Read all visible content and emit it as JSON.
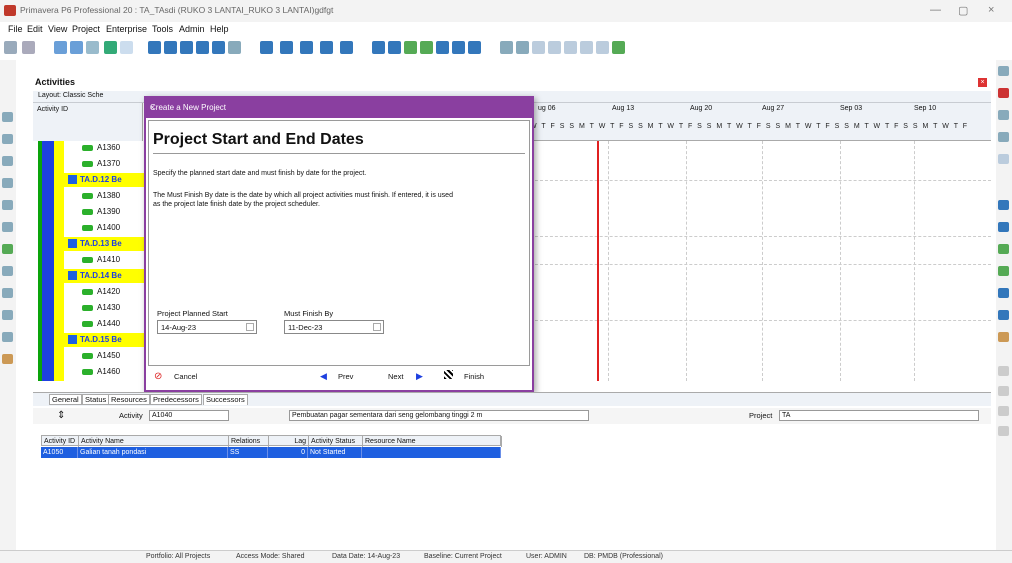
{
  "window": {
    "title": "Primavera P6 Professional 20 : TA_TAsdi (RUKO 3 LANTAI_RUKO 3 LANTAI)gdfgt",
    "minimize": "—",
    "restore": "▢",
    "close": "×"
  },
  "menu": [
    "File",
    "Edit",
    "View",
    "Project",
    "Enterprise",
    "Tools",
    "Admin",
    "Help"
  ],
  "activities_panel": {
    "title": "Activities",
    "layout": "Layout: Classic Sche",
    "column": "Activity ID"
  },
  "rows": [
    {
      "label": "A1360",
      "type": "act"
    },
    {
      "label": "A1370",
      "type": "act"
    },
    {
      "label": "TA.D.12 Be",
      "type": "wbs"
    },
    {
      "label": "A1380",
      "type": "act"
    },
    {
      "label": "A1390",
      "type": "act"
    },
    {
      "label": "A1400",
      "type": "act"
    },
    {
      "label": "TA.D.13 Be",
      "type": "wbs"
    },
    {
      "label": "A1410",
      "type": "act"
    },
    {
      "label": "TA.D.14 Be",
      "type": "wbs"
    },
    {
      "label": "A1420",
      "type": "act"
    },
    {
      "label": "A1430",
      "type": "act"
    },
    {
      "label": "A1440",
      "type": "act"
    },
    {
      "label": "TA.D.15 Be",
      "type": "wbs"
    },
    {
      "label": "A1450",
      "type": "act"
    },
    {
      "label": "A1460",
      "type": "act"
    }
  ],
  "gantt": {
    "weeks": [
      "ug 06",
      "Aug 13",
      "Aug 20",
      "Aug 27",
      "Sep 03",
      "Sep 10"
    ],
    "days": "W T F S S M T W T F S S M T W T F S S M T W T F S S M T W T F S S M T W T F S S M T W T F"
  },
  "dialog": {
    "title": "Create a New Project",
    "heading": "Project Start and End Dates",
    "desc1": "Specify the planned start date and must finish by date for the project.",
    "desc2": "The Must Finish By date is the date by which all project activities must finish.  If entered, it is used",
    "desc3": "as the project late finish date by the project scheduler.",
    "start_label": "Project Planned Start",
    "start_value": "14-Aug-23",
    "finish_label": "Must Finish By",
    "finish_value": "11-Dec-23",
    "cancel": "Cancel",
    "prev": "Prev",
    "next": "Next",
    "finish": "Finish"
  },
  "bottom": {
    "tabs": [
      "General",
      "Status",
      "Resources",
      "Predecessors",
      "Successors"
    ],
    "activity_label": "Activity",
    "activity_id": "A1040",
    "activity_name": "Pembuatan pagar sementara dari seng gelombang tinggi 2 m",
    "project_label": "Project",
    "project_id": "TA",
    "columns": [
      "Activity ID",
      "Activity Name",
      "Relations",
      "Lag",
      "Activity Status",
      "Resource Name"
    ],
    "row": {
      "id": "A1050",
      "name": "Galian tanah pondasi",
      "rel": "SS",
      "lag": "0",
      "status": "Not Started",
      "res": ""
    }
  },
  "status": {
    "portfolio": "Portfolio: All Projects",
    "access": "Access Mode: Shared",
    "date": "Data Date: 14-Aug-23",
    "baseline": "Baseline: Current Project",
    "user": "User: ADMIN",
    "db": "DB: PMDB (Professional)"
  },
  "colors": {
    "accent": "#8a3fa0",
    "wbs": "#ffff00",
    "select": "#1e5fe0",
    "dataline": "#e02020"
  }
}
